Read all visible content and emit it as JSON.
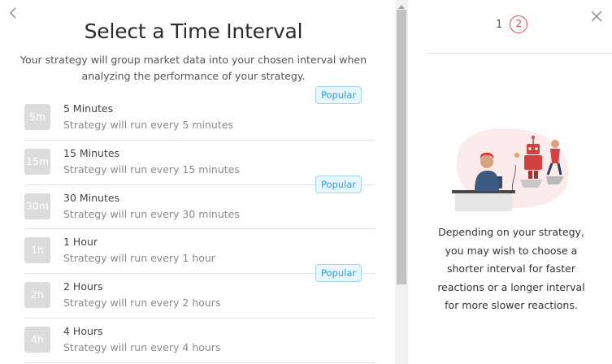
{
  "header": {
    "title": "Select a Time Interval",
    "subtitle": "Your strategy will group market data into your chosen interval when analyzing the performance of your strategy.",
    "back_icon": "chevron-left-icon"
  },
  "intervals": [
    {
      "badge": "5m",
      "name": "5 Minutes",
      "description": "Strategy will run every 5 minutes",
      "popular": "Popular"
    },
    {
      "badge": "15m",
      "name": "15 Minutes",
      "description": "Strategy will run every 15 minutes"
    },
    {
      "badge": "30m",
      "name": "30 Minutes",
      "description": "Strategy will run every 30 minutes",
      "popular": "Popular"
    },
    {
      "badge": "1h",
      "name": "1 Hour",
      "description": "Strategy will run every 1 hour"
    },
    {
      "badge": "2h",
      "name": "2 Hours",
      "description": "Strategy will run every 2 hours",
      "popular": "Popular"
    },
    {
      "badge": "4h",
      "name": "4 Hours",
      "description": "Strategy will run every 4 hours"
    }
  ],
  "stepper": {
    "step1": "1",
    "step2": "2",
    "active_color": "#e34a4a"
  },
  "sidebar": {
    "close_icon": "close-icon",
    "illustration": "robot-trading-illustration",
    "help_text": "Depending on your strategy, you may wish to choose a shorter interval for faster reactions or a longer interval for more slower reactions."
  },
  "colors": {
    "popular_bg": "#e9f6fd",
    "popular_border": "#9fd6f3",
    "popular_text": "#2c9fd9",
    "badge_bg": "#dcdcdc"
  }
}
